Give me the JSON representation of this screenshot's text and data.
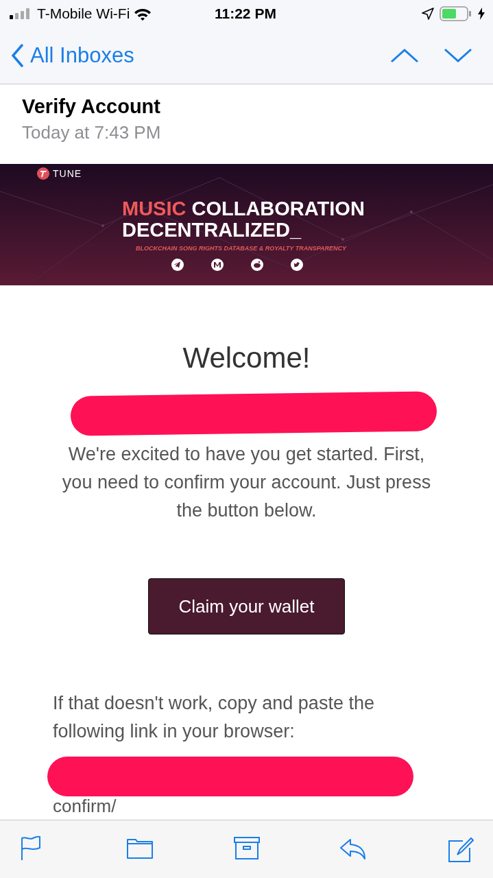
{
  "status_bar": {
    "carrier": "T-Mobile Wi-Fi",
    "time": "11:22 PM",
    "charging": true
  },
  "nav": {
    "back_label": "All Inboxes"
  },
  "message": {
    "subject": "Verify Account",
    "date": "Today at 7:43 PM"
  },
  "banner": {
    "brand": "TUNE",
    "headline_accent": "MUSIC",
    "headline_rest": "COLLABORATION",
    "headline_line2": "DECENTRALIZED_",
    "tagline": "BLOCKCHAIN SONG RIGHTS DATABASE & ROYALTY TRANSPARENCY",
    "social": [
      {
        "kind": "telegram"
      },
      {
        "kind": "medium"
      },
      {
        "kind": "reddit"
      },
      {
        "kind": "twitter"
      }
    ]
  },
  "body": {
    "heading": "Welcome!",
    "recipient_redacted": true,
    "intro": "We're excited to have you get started. First, you need to confirm your account. Just press the button below.",
    "button": "Claim your wallet",
    "fallback": "If that doesn't work, copy and paste the following link in your browser:",
    "link_redacted": true,
    "link_tail": "confirm/"
  },
  "toolbar": [
    {
      "kind": "flag"
    },
    {
      "kind": "folder"
    },
    {
      "kind": "archive"
    },
    {
      "kind": "reply"
    },
    {
      "kind": "compose"
    }
  ]
}
